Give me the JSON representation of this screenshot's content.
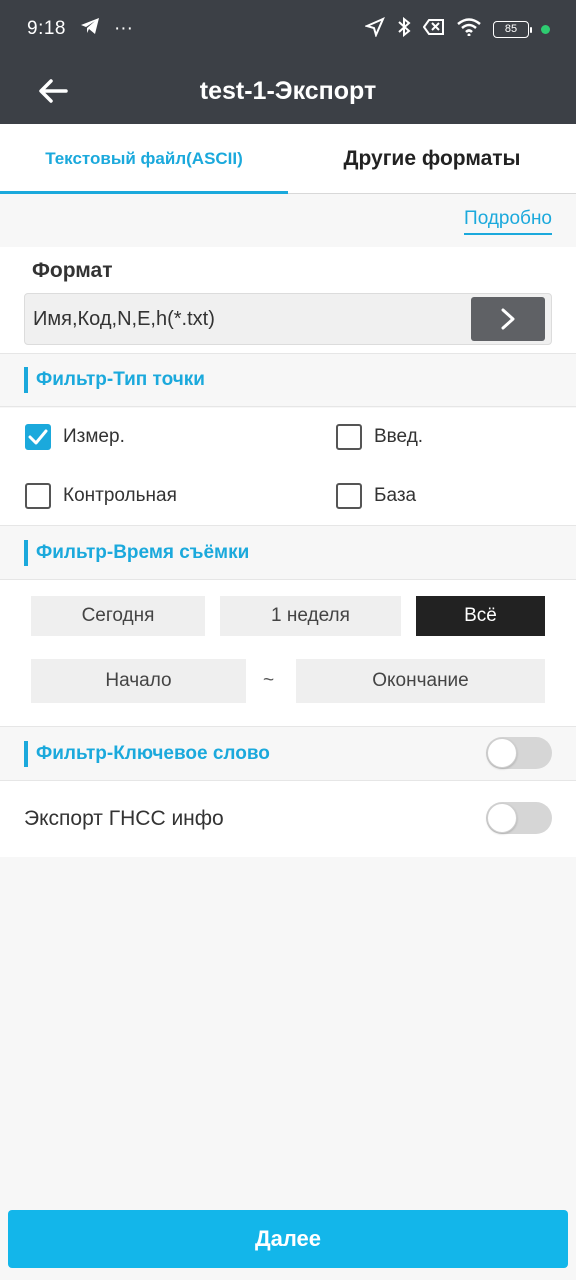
{
  "status_bar": {
    "time": "9:18",
    "more": "···",
    "battery": "85"
  },
  "app_bar": {
    "title": "test-1-Экспорт"
  },
  "tabs": [
    {
      "label": "Текстовый файл(ASCII)",
      "active": true
    },
    {
      "label": "Другие форматы",
      "active": false
    }
  ],
  "detail_link": "Подробно",
  "format": {
    "label": "Формат",
    "value": "Имя,Код,N,E,h(*.txt)"
  },
  "point_type_filter": {
    "title": "Фильтр-Тип точки",
    "options": [
      {
        "label": "Измер.",
        "checked": true
      },
      {
        "label": "Введ.",
        "checked": false
      },
      {
        "label": "Контрольная",
        "checked": false
      },
      {
        "label": "База",
        "checked": false
      }
    ]
  },
  "time_filter": {
    "title": "Фильтр-Время съёмки",
    "periods": [
      "Сегодня",
      "1 неделя",
      "Всё"
    ],
    "active_period": "Всё",
    "start_label": "Начало",
    "separator": "~",
    "end_label": "Окончание"
  },
  "keyword_filter": {
    "title": "Фильтр-Ключевое слово",
    "enabled": false
  },
  "gnss_export": {
    "label": "Экспорт ГНСС инфо",
    "enabled": false
  },
  "next_button": "Далее",
  "colors": {
    "accent": "#1ba9dc",
    "header": "#3c4046",
    "button": "#13b6ea"
  }
}
